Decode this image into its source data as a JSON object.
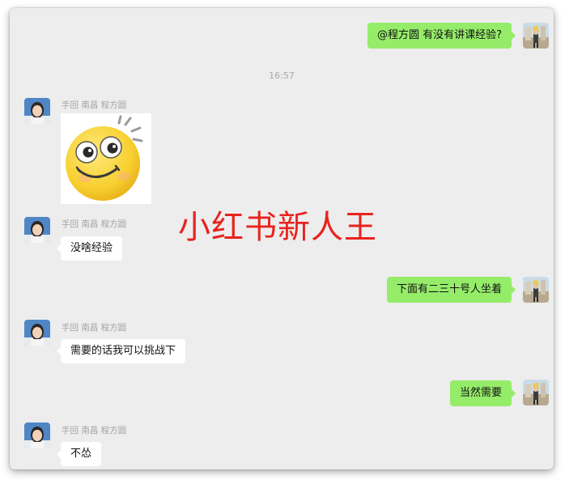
{
  "timestamp": "16:57",
  "messages": [
    {
      "direction": "out",
      "text": "@程方圆 有没有讲课经验?"
    },
    {
      "direction": "in",
      "sender": "手回 南昌 程方圆",
      "type": "sticker",
      "sticker_icon": "smiling-face-sticker"
    },
    {
      "direction": "in",
      "sender": "手回 南昌 程方圆",
      "text": "没啥经验"
    },
    {
      "direction": "out",
      "text": "下面有二三十号人坐着"
    },
    {
      "direction": "in",
      "sender": "手回 南昌 程方圆",
      "text": "需要的话我可以挑战下"
    },
    {
      "direction": "out",
      "text": "当然需要"
    },
    {
      "direction": "in",
      "sender": "手回 南昌 程方圆",
      "text": "不怂"
    }
  ],
  "watermark": "小红书新人王",
  "colors": {
    "background": "#ededed",
    "outgoing_bubble": "#95ec69",
    "incoming_bubble": "#ffffff",
    "watermark": "#e8231e",
    "meta_text": "#a3a3a3"
  }
}
